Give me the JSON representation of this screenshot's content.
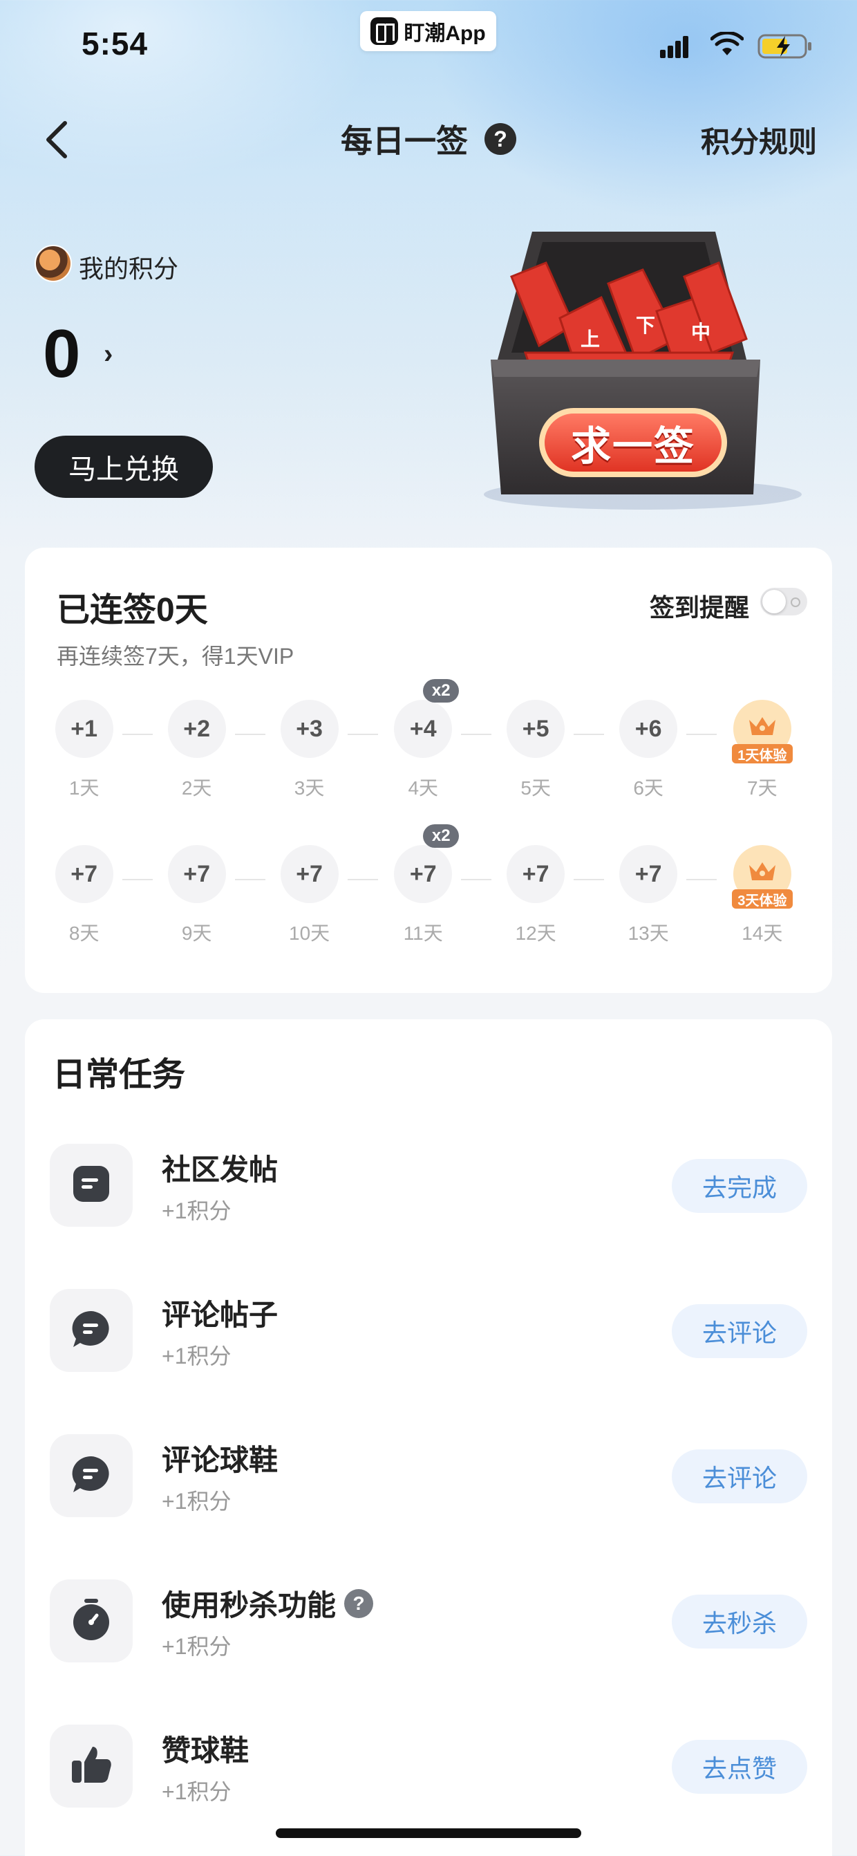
{
  "status_bar": {
    "time": "5:54",
    "app_badge": "盯潮App"
  },
  "nav": {
    "title": "每日一签",
    "rules_link": "积分规则"
  },
  "points": {
    "label": "我的积分",
    "value": "0",
    "redeem_button": "马上兑换"
  },
  "fortune_box": {
    "label": "求一签"
  },
  "checkin": {
    "streak_title": "已连签0天",
    "subtitle": "再连续签7天，得1天VIP",
    "reminder_label": "签到提醒",
    "reminder_on": false,
    "rows": [
      [
        {
          "points": "+1",
          "day": "1天"
        },
        {
          "points": "+2",
          "day": "2天"
        },
        {
          "points": "+3",
          "day": "3天"
        },
        {
          "points": "+4",
          "day": "4天",
          "badge": "x2"
        },
        {
          "points": "+5",
          "day": "5天"
        },
        {
          "points": "+6",
          "day": "6天"
        },
        {
          "vip": "1天体验",
          "day": "7天"
        }
      ],
      [
        {
          "points": "+7",
          "day": "8天"
        },
        {
          "points": "+7",
          "day": "9天"
        },
        {
          "points": "+7",
          "day": "10天"
        },
        {
          "points": "+7",
          "day": "11天",
          "badge": "x2"
        },
        {
          "points": "+7",
          "day": "12天"
        },
        {
          "points": "+7",
          "day": "13天"
        },
        {
          "vip": "3天体验",
          "day": "14天"
        }
      ]
    ]
  },
  "tasks": {
    "title": "日常任务",
    "items": [
      {
        "name": "社区发帖",
        "reward": "+1积分",
        "button": "去完成",
        "icon": "post-icon"
      },
      {
        "name": "评论帖子",
        "reward": "+1积分",
        "button": "去评论",
        "icon": "comment-icon"
      },
      {
        "name": "评论球鞋",
        "reward": "+1积分",
        "button": "去评论",
        "icon": "comment-icon"
      },
      {
        "name": "使用秒杀功能",
        "reward": "+1积分",
        "button": "去秒杀",
        "icon": "stopwatch-icon",
        "help": true
      },
      {
        "name": "赞球鞋",
        "reward": "+1积分",
        "button": "去点赞",
        "icon": "thumbs-up-icon"
      }
    ]
  },
  "colors": {
    "accent_blue": "#4b8ed8",
    "vip_orange": "#f08a3e",
    "dark_button": "#1e2023",
    "box_red": "#e03424"
  }
}
